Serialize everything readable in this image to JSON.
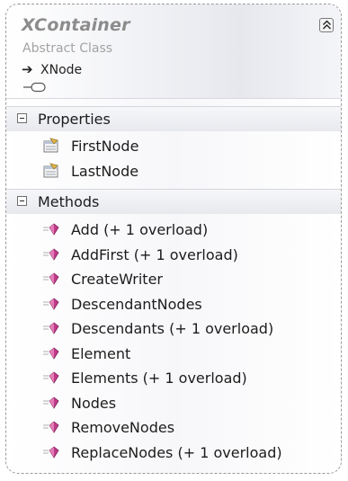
{
  "class": {
    "name": "XContainer",
    "kind": "Abstract Class",
    "base_class": "XNode"
  },
  "properties": {
    "label": "Properties",
    "items": [
      "FirstNode",
      "LastNode"
    ]
  },
  "methods": {
    "label": "Methods",
    "items": [
      "Add (+ 1 overload)",
      "AddFirst (+ 1 overload)",
      "CreateWriter",
      "DescendantNodes",
      "Descendants (+ 1 overload)",
      "Element",
      "Elements (+ 1 overload)",
      "Nodes",
      "RemoveNodes",
      "ReplaceNodes (+ 1 overload)"
    ]
  }
}
